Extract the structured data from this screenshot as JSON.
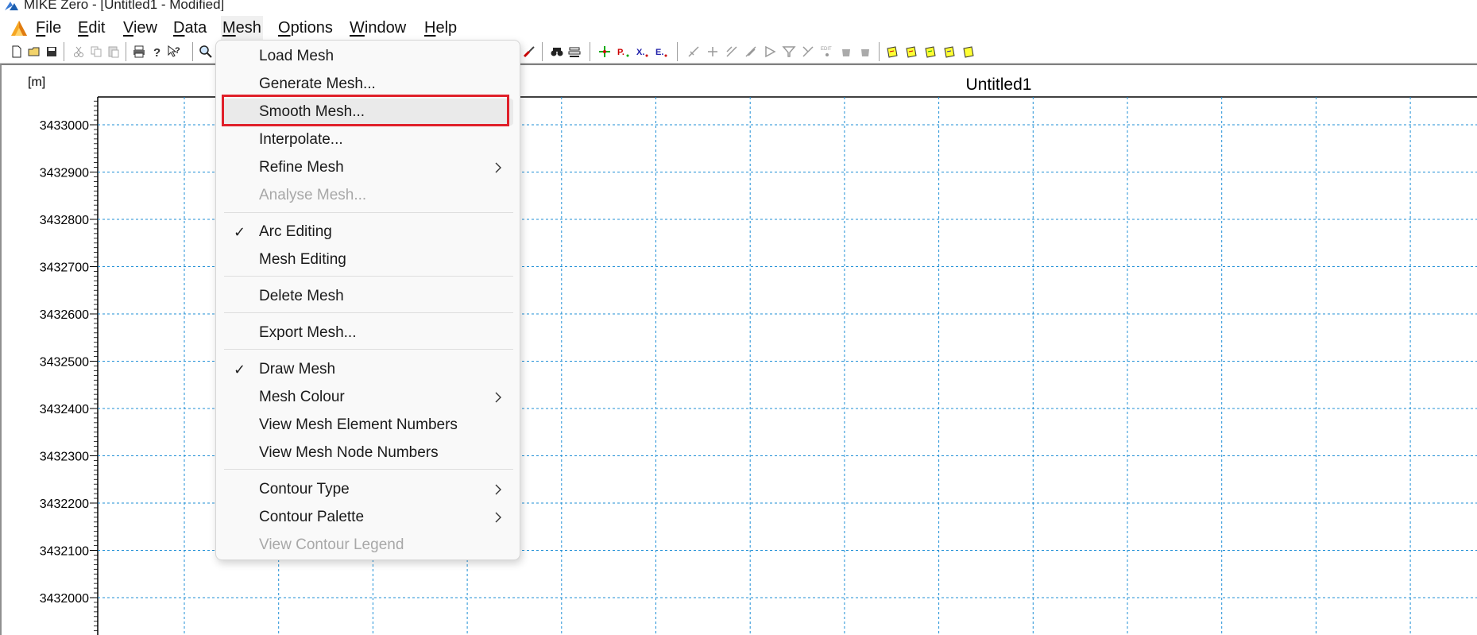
{
  "window": {
    "title": "MIKE Zero - [Untitled1 - Modified]"
  },
  "menubar": {
    "items": [
      {
        "label": "File",
        "key": "F",
        "rest": "ile"
      },
      {
        "label": "Edit",
        "key": "E",
        "rest": "dit"
      },
      {
        "label": "View",
        "key": "V",
        "rest": "iew"
      },
      {
        "label": "Data",
        "key": "D",
        "rest": "ata"
      },
      {
        "label": "Mesh",
        "key": "M",
        "rest": "esh"
      },
      {
        "label": "Options",
        "key": "O",
        "rest": "ptions"
      },
      {
        "label": "Window",
        "key": "W",
        "rest": "indow"
      },
      {
        "label": "Help",
        "key": "H",
        "rest": "elp"
      }
    ],
    "active": "Mesh"
  },
  "mesh_menu": {
    "items": [
      {
        "label": "Load Mesh",
        "checked": false,
        "submenu": false,
        "disabled": false
      },
      {
        "label": "Generate Mesh...",
        "checked": false,
        "submenu": false,
        "disabled": false
      },
      {
        "label": "Smooth Mesh...",
        "checked": false,
        "submenu": false,
        "disabled": false,
        "highlighted": true
      },
      {
        "label": "Interpolate...",
        "checked": false,
        "submenu": false,
        "disabled": false
      },
      {
        "label": "Refine Mesh",
        "checked": false,
        "submenu": true,
        "disabled": false
      },
      {
        "label": "Analyse Mesh...",
        "checked": false,
        "submenu": false,
        "disabled": true
      },
      {
        "label": "Arc Editing",
        "checked": true,
        "submenu": false,
        "disabled": false
      },
      {
        "label": "Mesh Editing",
        "checked": false,
        "submenu": false,
        "disabled": false
      },
      {
        "label": "Delete Mesh",
        "checked": false,
        "submenu": false,
        "disabled": false
      },
      {
        "label": "Export Mesh...",
        "checked": false,
        "submenu": false,
        "disabled": false
      },
      {
        "label": "Draw Mesh",
        "checked": true,
        "submenu": false,
        "disabled": false
      },
      {
        "label": "Mesh Colour",
        "checked": false,
        "submenu": true,
        "disabled": false
      },
      {
        "label": "View Mesh Element Numbers",
        "checked": false,
        "submenu": false,
        "disabled": false
      },
      {
        "label": "View Mesh Node Numbers",
        "checked": false,
        "submenu": false,
        "disabled": false
      },
      {
        "label": "Contour Type",
        "checked": false,
        "submenu": true,
        "disabled": false
      },
      {
        "label": "Contour Palette",
        "checked": false,
        "submenu": true,
        "disabled": false
      },
      {
        "label": "View Contour Legend",
        "checked": false,
        "submenu": false,
        "disabled": true
      }
    ],
    "check_glyph": "✓"
  },
  "plot": {
    "title": "Untitled1",
    "unit_label": "[m]",
    "y_ticks": [
      "3433000",
      "3432900",
      "3432800",
      "3432700",
      "3432600",
      "3432500",
      "3432400",
      "3432300",
      "3432200",
      "3432100",
      "3432000"
    ],
    "grid_color": "#1f8fd6"
  },
  "colors": {
    "highlight_border": "#e0202a",
    "menu_bg": "#f9f9f9"
  }
}
